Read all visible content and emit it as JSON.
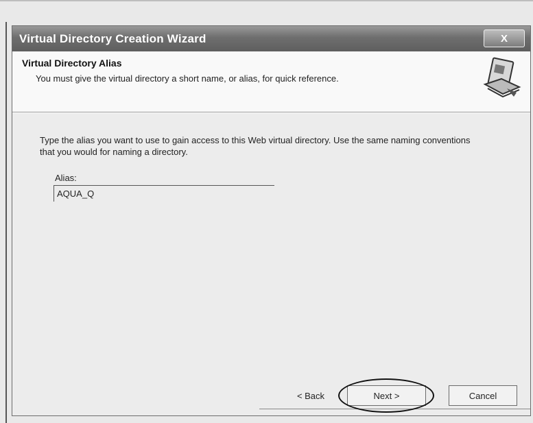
{
  "window": {
    "title": "Virtual Directory Creation Wizard",
    "close_glyph": "X"
  },
  "header": {
    "title": "Virtual Directory Alias",
    "subtitle": "You must give the virtual directory a short name, or alias, for quick reference.",
    "icon": "wizard-book-icon"
  },
  "body": {
    "instructions": "Type the alias you want to use to gain access to this Web virtual directory. Use the same naming conventions that you would for naming a directory.",
    "alias_label": "Alias:",
    "alias_value": "AQUA_Q"
  },
  "buttons": {
    "back": "< Back",
    "next": "Next >",
    "cancel": "Cancel"
  }
}
